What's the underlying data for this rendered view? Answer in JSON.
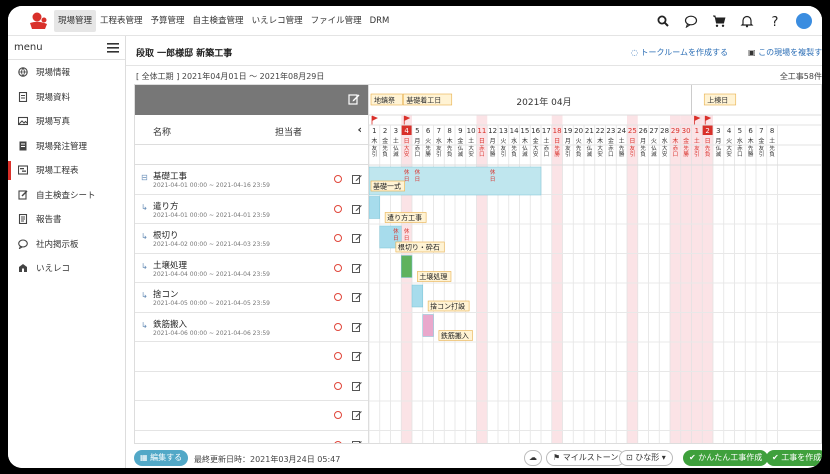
{
  "nav": {
    "items": [
      "現場管理",
      "工程表管理",
      "予算管理",
      "自主検査管理",
      "いえレコ管理",
      "ファイル管理",
      "DRM"
    ],
    "active_index": 0,
    "icons": [
      "search-icon",
      "chat-icon",
      "cart-icon",
      "bell-icon",
      "help-icon",
      "avatar"
    ]
  },
  "sidebar": {
    "header": "menu",
    "items": [
      {
        "label": "現場情報",
        "icon": "globe-icon"
      },
      {
        "label": "現場資料",
        "icon": "document-icon"
      },
      {
        "label": "現場写真",
        "icon": "photo-icon"
      },
      {
        "label": "現場発注管理",
        "icon": "order-icon"
      },
      {
        "label": "現場工程表",
        "icon": "schedule-icon",
        "active": true
      },
      {
        "label": "自主検査シート",
        "icon": "inspection-icon"
      },
      {
        "label": "報告書",
        "icon": "report-icon"
      },
      {
        "label": "社内掲示板",
        "icon": "board-icon"
      },
      {
        "label": "いえレコ",
        "icon": "house-icon"
      }
    ]
  },
  "page": {
    "title": "段取 一郎様邸 新築工事",
    "create_talkroom": "トークルームを作成する",
    "copy_site": "この現場を複製する",
    "period": "[ 全体工期 ] 2021年04月01日 ～ 2021年08月29日",
    "total_days": "全工事58件"
  },
  "task_header": {
    "name": "名称",
    "assignee": "担当者",
    "collapse": "‹"
  },
  "tasks": [
    {
      "name": "基礎工事",
      "dates": "2021-04-01 00:00 ~ 2021-04-16 23:59",
      "group": true
    },
    {
      "name": "遣り方",
      "dates": "2021-04-01 00:00 ~ 2021-04-01 23:59"
    },
    {
      "name": "根切り",
      "dates": "2021-04-02 00:00 ~ 2021-04-03 23:59"
    },
    {
      "name": "土壌処理",
      "dates": "2021-04-04 00:00 ~ 2021-04-04 23:59"
    },
    {
      "name": "捨コン",
      "dates": "2021-04-05 00:00 ~ 2021-04-05 23:59"
    },
    {
      "name": "鉄筋搬入",
      "dates": "2021-04-06 00:00 ~ 2021-04-06 23:59"
    }
  ],
  "empty_rows": 4,
  "gantt": {
    "month_label": "2021年 04月",
    "milestones": [
      "地鎮祭",
      "基礎着工日",
      "上棟日"
    ],
    "holiday_mark": "休\n日",
    "day_numbers": [
      1,
      2,
      3,
      4,
      5,
      6,
      7,
      8,
      9,
      10,
      11,
      12,
      13,
      14,
      15,
      16,
      17,
      18,
      19,
      20,
      21,
      22,
      23,
      24,
      25,
      26,
      27,
      28,
      29,
      30,
      1,
      2,
      3,
      4,
      5,
      6,
      7,
      8
    ],
    "weekdays": [
      "木",
      "金",
      "土",
      "日",
      "月",
      "火",
      "水",
      "木",
      "金",
      "土",
      "日",
      "月",
      "火",
      "水",
      "木",
      "金",
      "土",
      "日",
      "月",
      "火",
      "水",
      "木",
      "金",
      "土",
      "日",
      "月",
      "火",
      "水",
      "木",
      "金",
      "土",
      "日",
      "月",
      "火",
      "水",
      "木",
      "金",
      "土"
    ],
    "rokuyo": [
      "友引",
      "先負",
      "仏滅",
      "大安",
      "赤口",
      "先勝",
      "友引",
      "先負",
      "仏滅",
      "大安",
      "赤口",
      "先勝",
      "友引",
      "先負",
      "仏滅",
      "大安",
      "赤口",
      "先勝",
      "友引",
      "先負",
      "仏滅",
      "大安",
      "赤口",
      "先勝",
      "友引",
      "先負",
      "仏滅",
      "大安",
      "赤口",
      "先勝",
      "友引",
      "先負",
      "仏滅",
      "大安",
      "赤口",
      "先勝",
      "友引",
      "先負"
    ],
    "bar_labels": [
      "基礎一式",
      "遣り方工事",
      "根切り・砕石",
      "土壌処理",
      "捨コン打設",
      "鉄筋搬入"
    ],
    "colors": {
      "group_bar": "#bfe6ee",
      "bar_blue": "#a7dcec",
      "bar_green": "#5fb25d",
      "bar_pink": "#e9a8cc",
      "holiday_col": "#fbe3e6",
      "sunday": "#d9302a",
      "label_bg": "#fff3d4",
      "label_border": "#e8b04a"
    }
  },
  "bottom": {
    "edit": "編集する",
    "updated": "最終更新日時：2021年03月24日 05:47",
    "milestone_btn": "マイルストーン",
    "template_btn": "ひな形",
    "easy_create": "かんたん工事作成",
    "create_work": "工事を作成"
  }
}
